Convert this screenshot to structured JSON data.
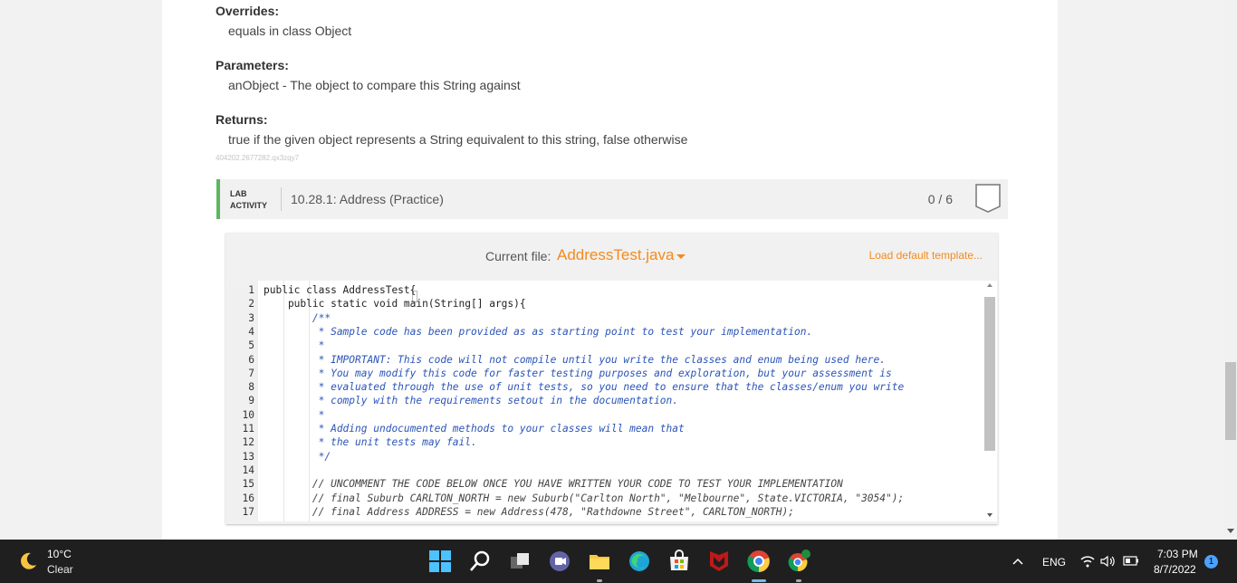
{
  "doc": {
    "overrides_label": "Overrides:",
    "overrides_text": "equals in class Object",
    "parameters_label": "Parameters:",
    "parameters_text": "anObject - The object to compare this String against",
    "returns_label": "Returns:",
    "returns_text": "true if the given object represents a String equivalent to this string, false otherwise",
    "id_text": "404202.2677282.qx3zqy7"
  },
  "lab": {
    "tag_line1": "LAB",
    "tag_line2": "ACTIVITY",
    "title": "10.28.1: Address (Practice)",
    "score": "0 / 6",
    "accent_color": "#5db75d"
  },
  "editor": {
    "current_file_label": "Current file:",
    "current_file": "AddressTest.java",
    "load_template": "Load default template...",
    "accent_color": "#f48a1d",
    "lines": [
      {
        "num": "1",
        "text": "public class AddressTest{",
        "style": "code"
      },
      {
        "num": "2",
        "text": "    public static void main(String[] args){",
        "style": "code"
      },
      {
        "num": "3",
        "text": "        /**",
        "style": "comment"
      },
      {
        "num": "4",
        "text": "         * Sample code has been provided as as starting point to test your implementation.",
        "style": "comment"
      },
      {
        "num": "5",
        "text": "         *",
        "style": "comment"
      },
      {
        "num": "6",
        "text": "         * IMPORTANT: This code will not compile until you write the classes and enum being used here.",
        "style": "comment"
      },
      {
        "num": "7",
        "text": "         * You may modify this code for faster testing purposes and exploration, but your assessment is",
        "style": "comment"
      },
      {
        "num": "8",
        "text": "         * evaluated through the use of unit tests, so you need to ensure that the classes/enum you write",
        "style": "comment"
      },
      {
        "num": "9",
        "text": "         * comply with the requirements setout in the documentation.",
        "style": "comment"
      },
      {
        "num": "10",
        "text": "         *",
        "style": "comment"
      },
      {
        "num": "11",
        "text": "         * Adding undocumented methods to your classes will mean that",
        "style": "comment"
      },
      {
        "num": "12",
        "text": "         * the unit tests may fail.",
        "style": "comment"
      },
      {
        "num": "13",
        "text": "         */",
        "style": "comment"
      },
      {
        "num": "14",
        "text": "",
        "style": "code"
      },
      {
        "num": "15",
        "text": "        // UNCOMMENT THE CODE BELOW ONCE YOU HAVE WRITTEN YOUR CODE TO TEST YOUR IMPLEMENTATION",
        "style": "comment-gray"
      },
      {
        "num": "16",
        "text": "        // final Suburb CARLTON_NORTH = new Suburb(\"Carlton North\", \"Melbourne\", State.VICTORIA, \"3054\");",
        "style": "comment-gray"
      },
      {
        "num": "17",
        "text": "        // final Address ADDRESS = new Address(478, \"Rathdowne Street\", CARLTON_NORTH);",
        "style": "comment-gray"
      }
    ]
  },
  "taskbar": {
    "weather_temp": "10°C",
    "weather_cond": "Clear",
    "weather_icon": "moon-icon",
    "apps": [
      "windows-start-icon",
      "search-icon",
      "task-view-icon",
      "teams-chat-icon",
      "file-explorer-icon",
      "edge-icon",
      "store-icon",
      "mcafee-icon",
      "chrome-icon",
      "chrome-profile-icon"
    ],
    "language": "ENG",
    "time": "7:03 PM",
    "date": "8/7/2022",
    "notification_count": "1"
  }
}
